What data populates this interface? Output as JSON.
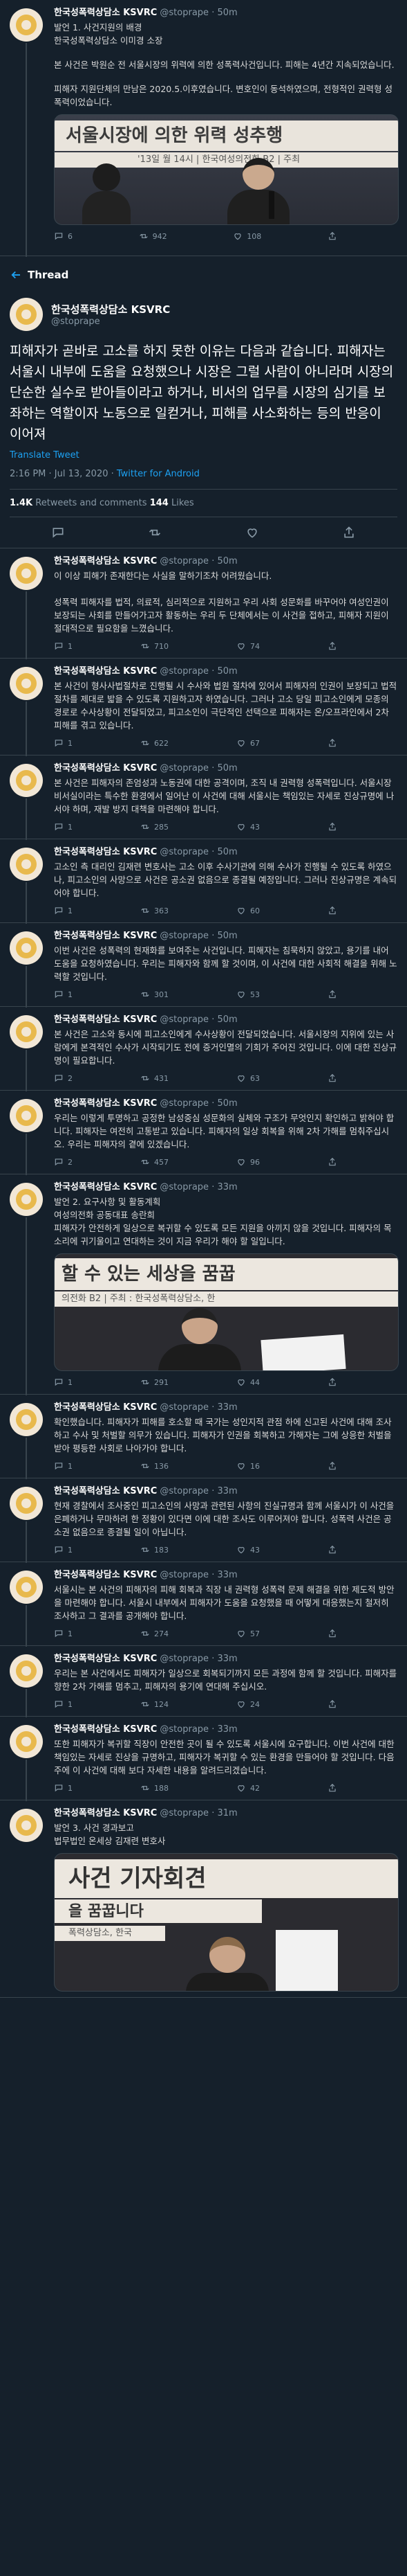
{
  "first_tweet": {
    "name": "한국성폭력상담소 KSVRC",
    "handle": "@stoprape",
    "time": "· 50m",
    "lines": [
      "발언 1. 사건지원의 배경",
      "한국성폭력상담소 이미경 소장",
      "본 사건은 박원순 전 서울시장의 위력에 의한 성폭력사건입니다. 피해는 4년간 지속되었습니다.",
      "피해자 지원단체의 만남은 2020.5.이후였습니다. 변호인이 동석하였으며, 전형적인 권력형 성폭력이었습니다."
    ],
    "media_banner": "서울시장에 의한 위력 성추행",
    "media_sub": "'13일 월 14시 | 한국여성의전화 B2 | 주최",
    "counts": {
      "reply": "6",
      "retweet": "942",
      "like": "108"
    }
  },
  "thread_label": "Thread",
  "main": {
    "name": "한국성폭력상담소 KSVRC",
    "handle": "@stoprape",
    "text": "피해자가 곧바로 고소를 하지 못한 이유는 다음과 같습니다. 피해자는 서울시 내부에 도움을 요청했으나 시장은 그럴 사람이 아니라며 시장의 단순한 실수로 받아들이라고 하거나, 비서의 업무를 시장의 심기를 보좌하는 역할이자 노동으로 일컫거나, 피해를 사소화하는 등의 반응이 이어져",
    "translate": "Translate Tweet",
    "timestamp": "2:16 PM · Jul 13, 2020 · ",
    "via": "Twitter for Android",
    "retweets_num": "1.4K",
    "retweets_label": " Retweets and comments   ",
    "likes_num": "144",
    "likes_label": " Likes"
  },
  "replies": [
    {
      "name": "한국성폭력상담소 KSVRC",
      "handle": "@stoprape",
      "time": "· 50m",
      "text": "이 이상 피해가 존재한다는 사실을 말하기조차 어려웠습니다.\n\n성폭력 피해자를 법적, 의료적, 심리적으로 지원하고 우리 사회 성문화를 바꾸어야 여성인권이 보장되는 사회를 만들어가고자 활동하는 우리 두 단체에서는 이 사건을 접하고, 피해자 지원이 절대적으로 필요함을 느꼈습니다.",
      "reply": "1",
      "retweet": "710",
      "like": "74"
    },
    {
      "name": "한국성폭력상담소 KSVRC",
      "handle": "@stoprape",
      "time": "· 50m",
      "text": "본 사건이 형사사법절차로 진행될 시 수사와 법원 절차에 있어서 피해자의 인권이 보장되고 법적 절차를 제대로 밟을 수 있도록 지원하고자 하였습니다. 그러나 고소 당일 피고소인에게 모종의 경로로 수사상황이 전달되었고, 피고소인이 극단적인 선택으로 피해자는 온/오프라인에서 2차 피해를 겪고 있습니다.",
      "reply": "1",
      "retweet": "622",
      "like": "67"
    },
    {
      "name": "한국성폭력상담소 KSVRC",
      "handle": "@stoprape",
      "time": "· 50m",
      "text": "본 사건은 피해자의 존엄성과 노동권에 대한 공격이며, 조직 내 권력형 성폭력입니다. 서울시장 비서실이라는 특수한 환경에서 일어난 이 사건에 대해 서울시는 책임있는 자세로 진상규명에 나서야 하며, 재발 방지 대책을 마련해야 합니다.",
      "reply": "1",
      "retweet": "285",
      "like": "43"
    },
    {
      "name": "한국성폭력상담소 KSVRC",
      "handle": "@stoprape",
      "time": "· 50m",
      "text": "고소인 측 대리인 김재련 변호사는 고소 이후 수사기관에 의해 수사가 진행될 수 있도록 하였으나, 피고소인의 사망으로 사건은 공소권 없음으로 종결될 예정입니다. 그러나 진상규명은 계속되어야 합니다.",
      "reply": "1",
      "retweet": "363",
      "like": "60"
    },
    {
      "name": "한국성폭력상담소 KSVRC",
      "handle": "@stoprape",
      "time": "· 50m",
      "text": "이번 사건은 성폭력의 현재화를 보여주는 사건입니다. 피해자는 침묵하지 않았고, 용기를 내어 도움을 요청하였습니다. 우리는 피해자와 함께 할 것이며, 이 사건에 대한 사회적 해결을 위해 노력할 것입니다.",
      "reply": "1",
      "retweet": "301",
      "like": "53"
    },
    {
      "name": "한국성폭력상담소 KSVRC",
      "handle": "@stoprape",
      "time": "· 50m",
      "text": "본 사건은 고소와 동시에 피고소인에게 수사상황이 전달되었습니다. 서울시장의 지위에 있는 사람에게 본격적인 수사가 시작되기도 전에 증거인멸의 기회가 주어진 것입니다. 이에 대한 진상규명이 필요합니다.",
      "reply": "2",
      "retweet": "431",
      "like": "63"
    },
    {
      "name": "한국성폭력상담소 KSVRC",
      "handle": "@stoprape",
      "time": "· 50m",
      "text": "우리는 이렇게 투명하고 공정한 남성중심 성문화의 실체와 구조가 무엇인지 확인하고 밝혀야 합니다. 피해자는 여전히 고통받고 있습니다. 피해자의 일상 회복을 위해 2차 가해를 멈춰주십시오. 우리는 피해자의 곁에 있겠습니다.",
      "reply": "2",
      "retweet": "457",
      "like": "96"
    },
    {
      "name": "한국성폭력상담소 KSVRC",
      "handle": "@stoprape",
      "time": "· 33m",
      "text": "발언 2. 요구사항 및 활동계획\n여성의전화 공동대표 송란희\n피해자가 안전하게 일상으로 복귀할 수 있도록 모든 지원을 아끼지 않을 것입니다. 피해자의 목소리에 귀기울이고 연대하는 것이 지금 우리가 해야 할 일입니다.",
      "reply": "1",
      "retweet": "291",
      "like": "44",
      "media": "photo1"
    },
    {
      "name": "한국성폭력상담소 KSVRC",
      "handle": "@stoprape",
      "time": "· 33m",
      "text": "확인했습니다. 피해자가 피해를 호소할 때 국가는 성인지적 관점 하에 신고된 사건에 대해 조사하고 수사 및 처벌할 의무가 있습니다. 피해자가 인권을 회복하고 가해자는 그에 상응한 처벌을 받아 평등한 사회로 나아가야 합니다.",
      "reply": "1",
      "retweet": "136",
      "like": "16"
    },
    {
      "name": "한국성폭력상담소 KSVRC",
      "handle": "@stoprape",
      "time": "· 33m",
      "text": "현재 경찰에서 조사중인 피고소인의 사망과 관련된 사항의 진실규명과 함께 서울시가 이 사건을 은폐하거나 무마하려 한 정황이 있다면 이에 대한 조사도 이루어져야 합니다. 성폭력 사건은 공소권 없음으로 종결될 일이 아닙니다.",
      "reply": "1",
      "retweet": "183",
      "like": "43"
    },
    {
      "name": "한국성폭력상담소 KSVRC",
      "handle": "@stoprape",
      "time": "· 33m",
      "text": "서울시는 본 사건의 피해자의 피해 회복과 직장 내 권력형 성폭력 문제 해결을 위한 제도적 방안을 마련해야 합니다. 서울시 내부에서 피해자가 도움을 요청했을 때 어떻게 대응했는지 철저히 조사하고 그 결과를 공개해야 합니다.",
      "reply": "1",
      "retweet": "274",
      "like": "57"
    },
    {
      "name": "한국성폭력상담소 KSVRC",
      "handle": "@stoprape",
      "time": "· 33m",
      "text": "우리는 본 사건에서도 피해자가 일상으로 회복되기까지 모든 과정에 함께 할 것입니다. 피해자를 향한 2차 가해를 멈추고, 피해자의 용기에 연대해 주십시오.",
      "reply": "1",
      "retweet": "124",
      "like": "24"
    },
    {
      "name": "한국성폭력상담소 KSVRC",
      "handle": "@stoprape",
      "time": "· 33m",
      "text": "또한 피해자가 복귀할 직장이 안전한 곳이 될 수 있도록 서울시에 요구합니다. 이번 사건에 대한 책임있는 자세로 진상을 규명하고, 피해자가 복귀할 수 있는 환경을 만들어야 할 것입니다. 다음주에 이 사건에 대해 보다 자세한 내용을 알려드리겠습니다.",
      "reply": "1",
      "retweet": "188",
      "like": "42"
    },
    {
      "name": "한국성폭력상담소 KSVRC",
      "handle": "@stoprape",
      "time": "· 31m",
      "text": "발언 3. 사건 경과보고\n법무법인 온세상 김재련 변호사",
      "reply": "",
      "retweet": "",
      "like": "",
      "media": "photo2"
    }
  ],
  "photo1": {
    "banner": "할 수 있는 세상을 꿈꿉",
    "sub": "의전화 B2 | 주최 : 한국성폭력상담소, 한"
  },
  "photo2": {
    "banner": "사건 기자회견",
    "sub": "을 꿈꿉니다",
    "sub2": "폭력상담소, 한국"
  },
  "colors": {
    "bg": "#15202b",
    "accent": "#1da1f2",
    "muted": "#8899a6",
    "border": "#38444d"
  }
}
